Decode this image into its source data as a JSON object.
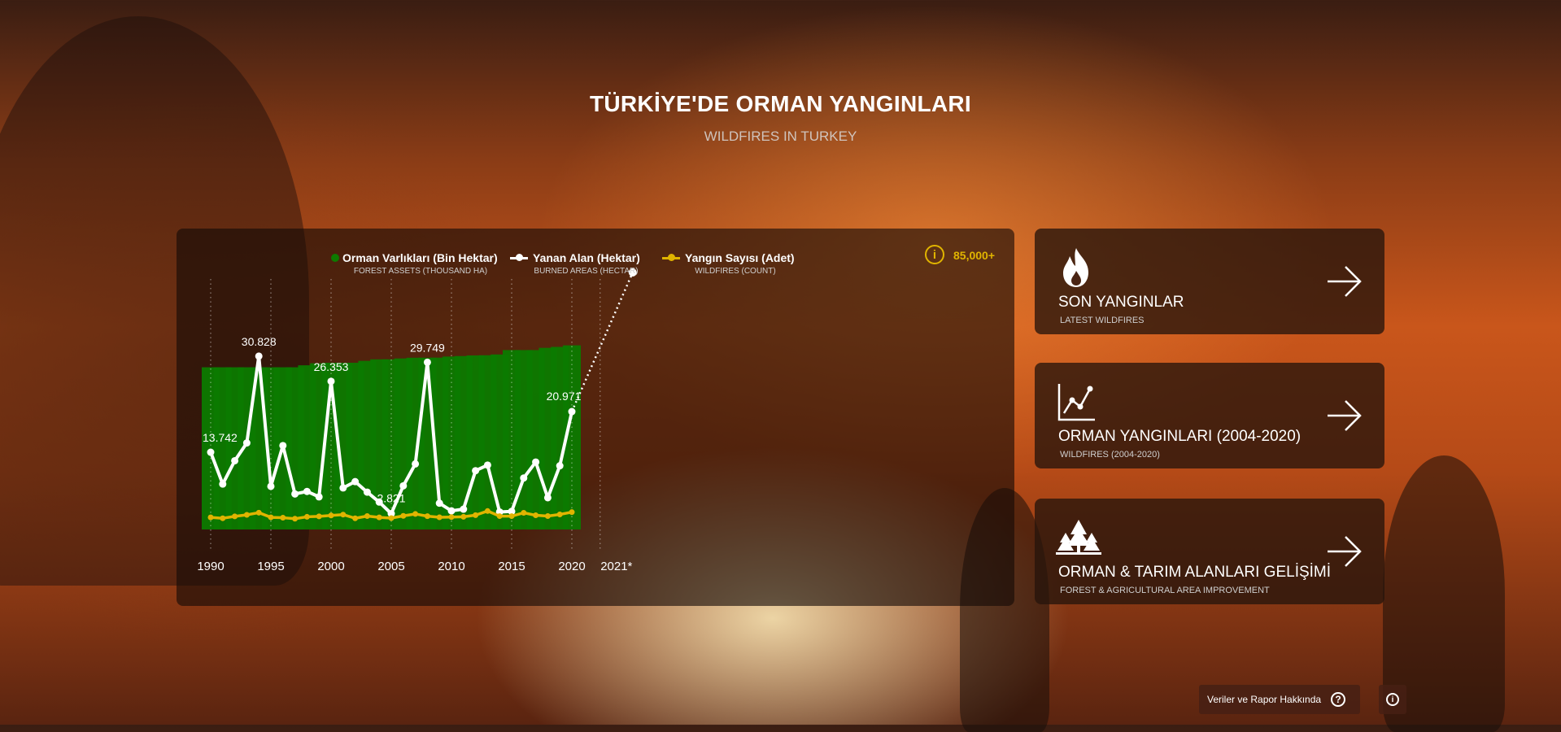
{
  "header": {
    "title": "TÜRKİYE'DE ORMAN YANGINLARI",
    "subtitle": "WILDFIRES IN TURKEY"
  },
  "chart_data": {
    "type": "bar+line",
    "legend": [
      {
        "label": "Orman Varlıkları (Bin Hektar)",
        "sub": "FOREST ASSETS (THOUSAND HA)",
        "color": "#0e7a00"
      },
      {
        "label": "Yanan Alan (Hektar)",
        "sub": "BURNED AREAS (HECTAR)",
        "color": "#ffffff"
      },
      {
        "label": "Yangın Sayısı (Adet)",
        "sub": "WILDFIRES (COUNT)",
        "color": "#e0b400"
      }
    ],
    "x": [
      1990,
      1991,
      1992,
      1993,
      1994,
      1995,
      1996,
      1997,
      1998,
      1999,
      2000,
      2001,
      2002,
      2003,
      2004,
      2005,
      2006,
      2007,
      2008,
      2009,
      2010,
      2011,
      2012,
      2013,
      2014,
      2015,
      2016,
      2017,
      2018,
      2019,
      2020
    ],
    "x_tick_labels": [
      "1990",
      "1995",
      "2000",
      "2005",
      "2010",
      "2015",
      "2020",
      "2021*"
    ],
    "series": [
      {
        "name": "Orman Varlıkları (Bin Hektar)",
        "kind": "bar",
        "values": [
          20199,
          20199,
          20199,
          20199,
          20199,
          20199,
          20199,
          20199,
          20450,
          20700,
          20763,
          20763,
          20763,
          21000,
          21189,
          21189,
          21300,
          21390,
          21390,
          21400,
          21537,
          21600,
          21678,
          21700,
          21800,
          22343,
          22343,
          22342,
          22621,
          22740,
          22933
        ]
      },
      {
        "name": "Yanan Alan (Hektar)",
        "kind": "line",
        "values": [
          13742,
          8081,
          12232,
          15393,
          30828,
          7676,
          14922,
          6316,
          6764,
          5804,
          26353,
          7394,
          8514,
          6644,
          4876,
          2821,
          7762,
          11664,
          29749,
          4679,
          3317,
          3612,
          10455,
          11456,
          3117,
          3219,
          9156,
          11993,
          5644,
          11332,
          20971
        ],
        "projection": {
          "x": "2021*",
          "label": "85,000+"
        },
        "data_labels": [
          {
            "x": 1990,
            "label": "13.742"
          },
          {
            "x": 1994,
            "label": "30.828"
          },
          {
            "x": 2000,
            "label": "26.353"
          },
          {
            "x": 2005,
            "label": "2.821"
          },
          {
            "x": 2008,
            "label": "29.749"
          },
          {
            "x": 2020,
            "label": "20.971"
          }
        ]
      },
      {
        "name": "Yangın Sayısı (Adet)",
        "kind": "line",
        "values": [
          1750,
          1480,
          2070,
          2545,
          3239,
          1770,
          1645,
          1339,
          1932,
          2075,
          2353,
          2631,
          1471,
          2177,
          1762,
          1530,
          2227,
          2829,
          2135,
          1793,
          1861,
          1954,
          2450,
          3755,
          2149,
          2150,
          3188,
          2411,
          2167,
          2688,
          3399
        ]
      }
    ],
    "annotation_icon": "info-icon",
    "grid": "vertical dotted at 5-year ticks"
  },
  "cards": [
    {
      "title": "SON YANGINLAR",
      "sub": "LATEST WILDFIRES",
      "icon": "flame-icon"
    },
    {
      "title": "ORMAN YANGINLARI (2004-2020)",
      "sub": "WILDFIRES (2004-2020)",
      "icon": "line-chart-icon"
    },
    {
      "title": "ORMAN & TARIM ALANLARI GELİŞİMİ",
      "sub": "FOREST & AGRICULTURAL AREA IMPROVEMENT",
      "icon": "trees-icon"
    }
  ],
  "footer": {
    "about_label": "Veriler ve Rapor Hakkında",
    "help_glyph": "?",
    "info_glyph": "i"
  }
}
